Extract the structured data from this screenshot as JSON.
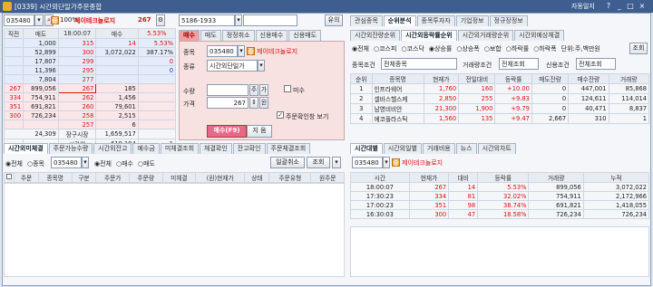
{
  "window": {
    "title": "[0339] 시간외단일가주문종합",
    "autosave": "자동일지",
    "help": "?",
    "min": "_",
    "max": "□",
    "close": "×"
  },
  "left": {
    "code": "035480",
    "pct_label": "100%",
    "stock_name": "제이테크놀로지",
    "count": "267",
    "head": [
      "직전",
      "매도",
      "18:00:07",
      "매수",
      "5.53%"
    ],
    "ask_rows": [
      [
        "",
        "1,000",
        "315",
        "14",
        "5.53%"
      ],
      [
        "",
        "52,899",
        "300",
        "3,072,022",
        "387.17%"
      ],
      [
        "",
        "17,807",
        "299",
        "",
        "0"
      ],
      [
        "",
        "11,396",
        "295",
        "",
        "0"
      ],
      [
        "",
        "7,804",
        "277",
        "",
        ""
      ]
    ],
    "bid_rows": [
      [
        "267",
        "899,056",
        "267",
        "185",
        ""
      ],
      [
        "334",
        "754,911",
        "262",
        "1,456",
        ""
      ],
      [
        "351",
        "691,821",
        "260",
        "79,601",
        ""
      ],
      [
        "300",
        "726,234",
        "258",
        "2,515",
        ""
      ],
      [
        "",
        "",
        "257",
        "6",
        ""
      ]
    ],
    "sum1": "24,309",
    "sum1_label": "장구시장",
    "sum2": "1,659,517",
    "time": "시간외",
    "sum3": "619,194",
    "sum3_n": "1"
  },
  "order": {
    "tabs": [
      "매수",
      "매도",
      "정정취소",
      "신용매수",
      "신용매도"
    ],
    "code_label": "종목",
    "code": "035480",
    "name": "제이테크놀로지",
    "type_label": "종류",
    "type": "시간외단일가",
    "qty_label": "수량",
    "qty_unit": "주",
    "price_label": "가격",
    "price": "267",
    "price_unit": "원",
    "check_misu": "미수",
    "check_pos": "주문확인창 보기",
    "buy_btn": "매수(F9)",
    "clear_btn": "지 움"
  },
  "upper_mid": {
    "code": "5186-1933",
    "lookup": "유의"
  },
  "right": {
    "tabs": [
      "관심종목",
      "순위분석",
      "종목투자자",
      "기업정보",
      "정규장정보"
    ],
    "subtabs": [
      "시간외잔량순위",
      "시간외등락률순위",
      "시간외거래량순위",
      "시간외예상체결"
    ],
    "filters": [
      "전체",
      "코스피",
      "코스닥",
      "상승률",
      "상승폭",
      "보합",
      "하락률",
      "하락폭"
    ],
    "unit": "단위:주,백만원",
    "search": "조회",
    "cond1_label": "종목조건",
    "cond1": "전체종목",
    "cond2_label": "거래량조건",
    "cond2": "전체조회",
    "cond3_label": "신용조건",
    "cond3": "전체조회",
    "cols": [
      "순위",
      "종목명",
      "현재가",
      "전일대비",
      "등락률",
      "매도잔량",
      "매수잔량",
      "거래량"
    ],
    "rows": [
      [
        "1",
        "인프라웨어",
        "1,760",
        "160",
        "+10.00",
        "0",
        "447,001",
        "85,868"
      ],
      [
        "2",
        "셀바스헬스케",
        "2,850",
        "255",
        "+9.83",
        "0",
        "124,611",
        "114,014"
      ],
      [
        "3",
        "남영비비안",
        "21,300",
        "1,900",
        "+9.79",
        "0",
        "40,471",
        "8,837"
      ],
      [
        "4",
        "에코플라스틱",
        "1,560",
        "135",
        "+9.47",
        "2,667",
        "310",
        "1"
      ]
    ]
  },
  "bottom_left": {
    "tabs": [
      "시간외미체결",
      "주문가능수량",
      "시간외잔고",
      "예수금",
      "미체결조회",
      "체결확인",
      "잔고확인",
      "주문체결조회"
    ],
    "radio": [
      "전체",
      "종목"
    ],
    "code": "035480",
    "radio2": [
      "전체",
      "매수",
      "매도"
    ],
    "cancel_all": "일괄취소",
    "search": "조회",
    "cols": [
      "주문",
      "종목명",
      "구분",
      "주문가",
      "주문량",
      "미체결",
      "(원)현재가",
      "상태",
      "주문유형",
      "원주문"
    ]
  },
  "bottom_right": {
    "tabs": [
      "시간대별",
      "시간외일별",
      "거래비용",
      "뉴스",
      "시간외차트"
    ],
    "code": "035480",
    "name": "제이테크놀로지",
    "cols": [
      "시간",
      "현재가",
      "대비",
      "등락률",
      "거래량",
      "누적"
    ],
    "rows": [
      [
        "18:00:07",
        "267",
        "14",
        "5.53%",
        "899,056",
        "3,072,022"
      ],
      [
        "17:30:23",
        "334",
        "81",
        "32.02%",
        "754,911",
        "2,172,966"
      ],
      [
        "17:00:23",
        "351",
        "98",
        "38.74%",
        "691,821",
        "1,418,055"
      ],
      [
        "16:30:03",
        "300",
        "47",
        "18.58%",
        "726,234",
        "726,234"
      ]
    ]
  }
}
